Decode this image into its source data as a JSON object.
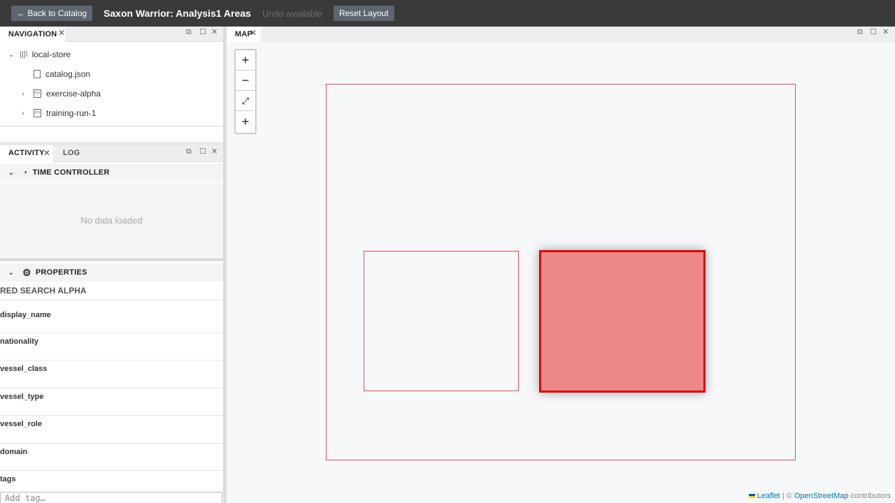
{
  "topbar": {
    "back_label": "← Back to Catalog",
    "title": "Saxon Warrior: Analysis1 Areas",
    "undo_status": "Undo available",
    "reset_label": "Reset Layout"
  },
  "navigation": {
    "tab_label": "NAVIGATION",
    "tree": [
      {
        "label": "local-store",
        "icon": "library-icon"
      },
      {
        "label": "catalog.json",
        "icon": "file-icon"
      },
      {
        "label": "exercise-alpha",
        "icon": "code-file-icon"
      },
      {
        "label": "training-run-1",
        "icon": "code-file-icon"
      }
    ]
  },
  "activity": {
    "tabs": [
      "ACTIVITY",
      "LOG"
    ],
    "time_controller_label": "TIME CONTROLLER",
    "empty_message": "No data loaded",
    "properties_label": "PROPERTIES",
    "selected_name": "RED SEARCH ALPHA",
    "fields": [
      "display_name",
      "nationality",
      "vessel_class",
      "vessel_type",
      "vessel_role",
      "domain",
      "tags"
    ],
    "tag_placeholder": "Add tag…"
  },
  "map": {
    "tab_label": "MAP",
    "zoom_in": "+",
    "zoom_out": "−",
    "add": "+",
    "attribution_leaflet": "Leaflet",
    "attribution_sep": " | © ",
    "attribution_osm": "OpenStreetMap",
    "attribution_suffix": " contributors",
    "colors": {
      "outline": "#e05050",
      "selected_fill": "#ee8888",
      "selected_border": "#e00000"
    }
  }
}
